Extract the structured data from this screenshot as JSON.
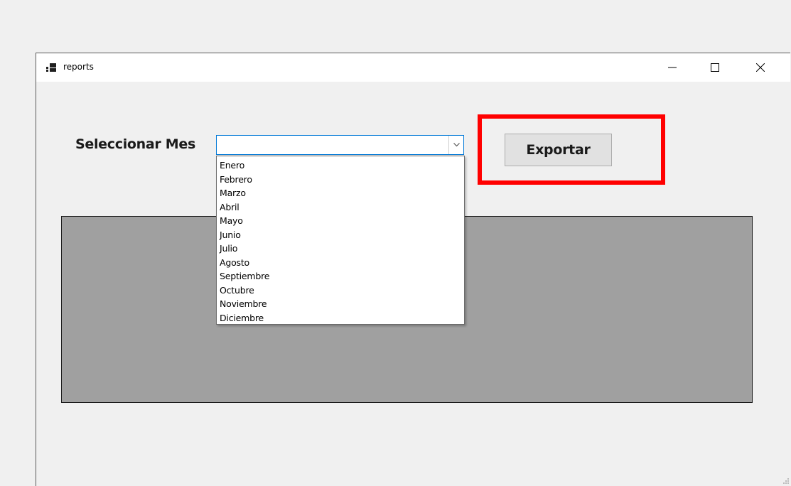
{
  "window": {
    "title": "reports",
    "controls": {
      "minimize_icon": "minimize-icon",
      "maximize_icon": "maximize-icon",
      "close_icon": "close-icon"
    }
  },
  "form": {
    "month_label": "Seleccionar Mes",
    "month_selected": "",
    "month_options": [
      "Enero",
      "Febrero",
      "Marzo",
      "Abril",
      "Mayo",
      "Junio",
      "Julio",
      "Agosto",
      "Septiembre",
      "Octubre",
      "Noviembre",
      "Diciembre"
    ],
    "export_label": "Exportar"
  },
  "colors": {
    "highlight": "#ff0000",
    "focus_border": "#0078d7",
    "panel": "#a0a0a0",
    "window_bg": "#f0f0f0"
  }
}
